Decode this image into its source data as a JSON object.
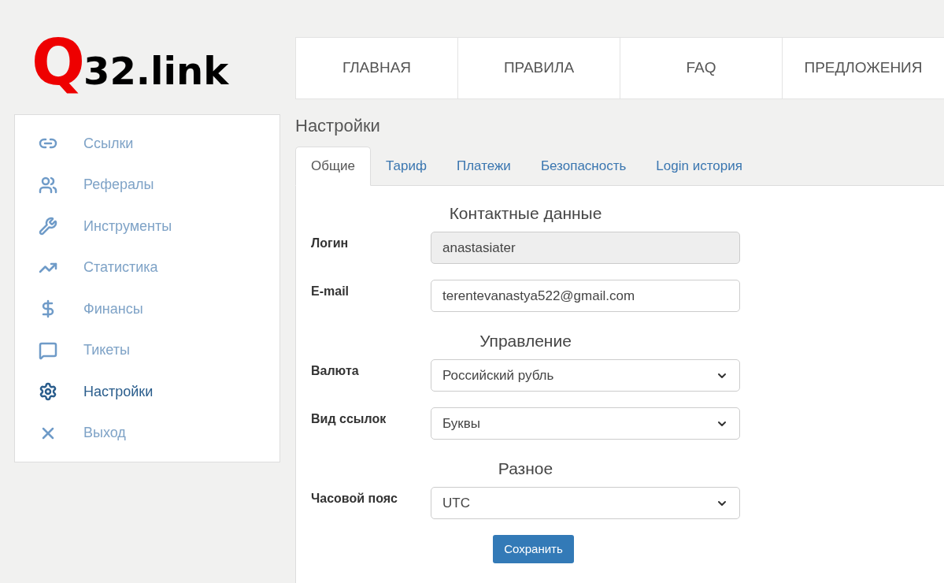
{
  "logo": {
    "mark": "Q",
    "text": "32.link"
  },
  "nav": [
    "ГЛАВНАЯ",
    "ПРАВИЛА",
    "FAQ",
    "ПРЕДЛОЖЕНИЯ"
  ],
  "sidebar": {
    "items": [
      {
        "label": "Ссылки",
        "selected": false
      },
      {
        "label": "Рефералы",
        "selected": false
      },
      {
        "label": "Инструменты",
        "selected": false
      },
      {
        "label": "Статистика",
        "selected": false
      },
      {
        "label": "Финансы",
        "selected": false
      },
      {
        "label": "Тикеты",
        "selected": false
      },
      {
        "label": "Настройки",
        "selected": true
      },
      {
        "label": "Выход",
        "selected": false
      }
    ]
  },
  "page_title": "Настройки",
  "tabs": [
    {
      "label": "Общие",
      "selected": true
    },
    {
      "label": "Тариф",
      "selected": false
    },
    {
      "label": "Платежи",
      "selected": false
    },
    {
      "label": "Безопасность",
      "selected": false
    },
    {
      "label": "Login история",
      "selected": false
    }
  ],
  "sections": [
    {
      "heading": "Контактные данные",
      "fields": [
        {
          "label": "Логин",
          "kind": "input",
          "value": "anastasiater",
          "disabled": true
        },
        {
          "label": "E-mail",
          "kind": "input",
          "value": "terentevanastya522@gmail.com",
          "disabled": false
        }
      ]
    },
    {
      "heading": "Управление",
      "fields": [
        {
          "label": "Валюта",
          "kind": "select",
          "value": "Российский рубль"
        },
        {
          "label": "Вид ссылок",
          "kind": "select",
          "value": "Буквы"
        }
      ]
    },
    {
      "heading": "Разное",
      "fields": [
        {
          "label": "Часовой пояс",
          "kind": "select",
          "value": "UTC"
        }
      ]
    }
  ],
  "save_button": "Сохранить"
}
